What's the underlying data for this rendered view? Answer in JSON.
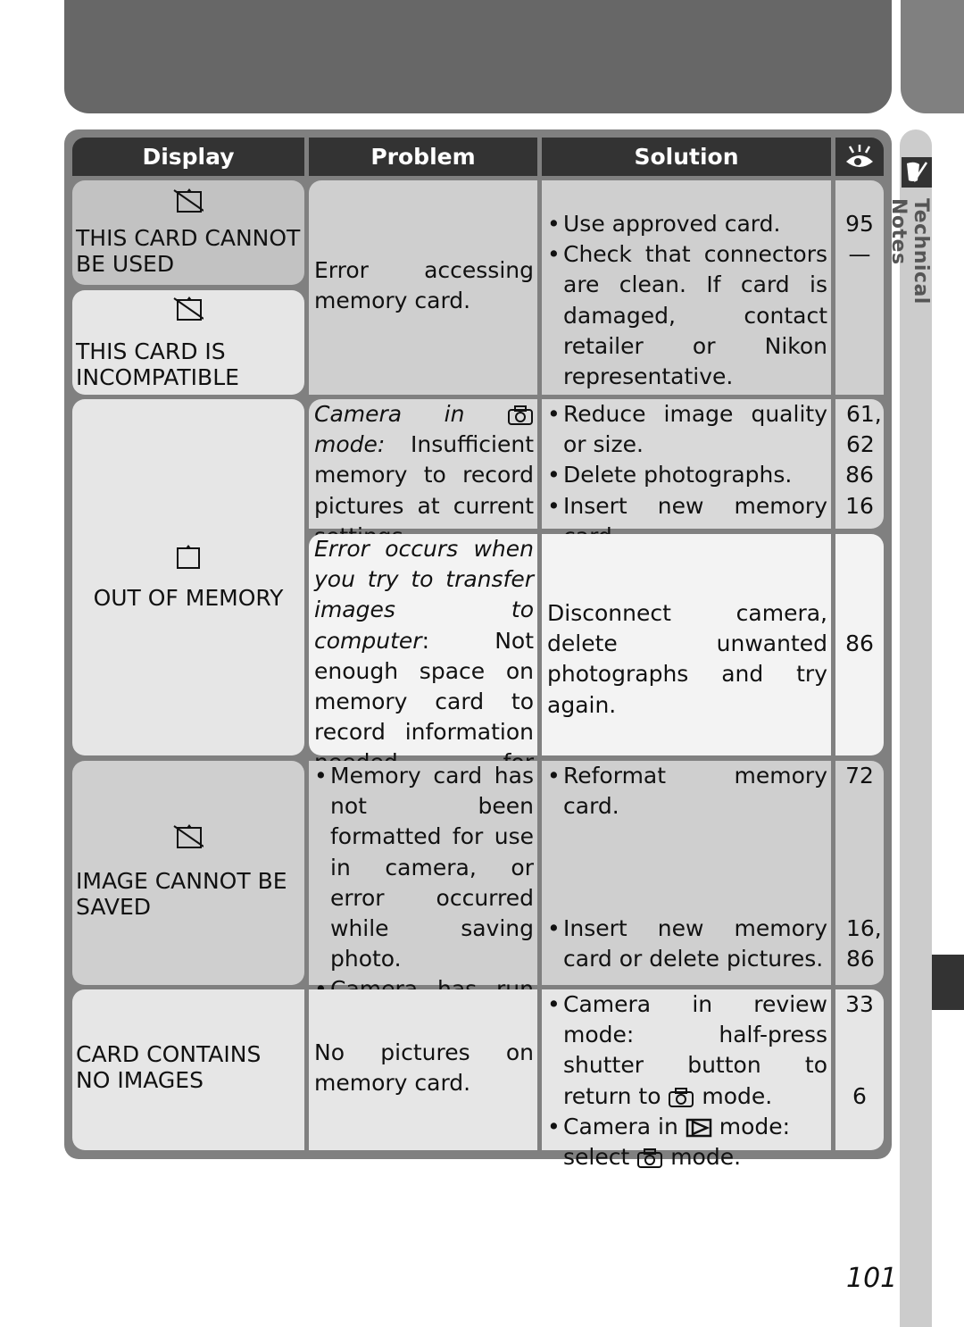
{
  "side_tab": {
    "label": "Technical Notes",
    "icon": "pencil-note-icon"
  },
  "header": {
    "display": "Display",
    "problem": "Problem",
    "solution": "Solution",
    "page_icon": "eye-icon"
  },
  "rows": [
    {
      "displays": [
        {
          "icon": "card-crossed-icon",
          "text": "THIS CARD CANNOT BE USED"
        },
        {
          "icon": "card-crossed-icon",
          "text": "THIS CARD IS INCOMPATIBLE"
        }
      ],
      "problem": "Error accessing memory card.",
      "solutions": [
        {
          "text": "Use approved card.",
          "page": "95"
        },
        {
          "text": "Check that connectors are clean.  If card is damaged, contact retailer or Nikon representative.",
          "page": "—"
        }
      ]
    },
    {
      "display": {
        "icon": "card-icon",
        "text": "OUT OF MEMORY"
      },
      "subrows": [
        {
          "problem_italic": "Camera in [camera] mode:",
          "problem_italic_pre": "Camera in",
          "problem_italic_post": "mode:",
          "problem": "Insufficient memory to record pictures at current settings.",
          "solutions": [
            {
              "text": "Reduce image quality or size.",
              "page": "61, 62"
            },
            {
              "text": "Delete photographs.",
              "page": "86"
            },
            {
              "text": "Insert new memory card.",
              "page": "16"
            }
          ]
        },
        {
          "problem_italic": "Error occurs when you try to transfer images to computer",
          "problem": ": Not enough space on memory card to record information needed for transfer.",
          "solution": "Disconnect camera, delete unwanted photographs and try again.",
          "page": "86"
        }
      ]
    },
    {
      "display": {
        "icon": "card-crossed-icon",
        "text": "IMAGE CANNOT BE SAVED"
      },
      "problems": [
        "Memory card has not been formatted for use in camera, or error occurred while saving photo.",
        "Camera has run out of file numbers."
      ],
      "solutions": [
        {
          "text": "Reformat memory card.",
          "page": "72"
        },
        {
          "text": "Insert new memory card or delete pictures.",
          "page": "16, 86"
        }
      ]
    },
    {
      "display": {
        "text": "CARD CONTAINS NO IMAGES"
      },
      "problem": "No pictures on memory card.",
      "solutions": [
        {
          "pre": "Camera in review mode: half-press shutter button to return to",
          "post": "mode.",
          "page": "33"
        },
        {
          "pre": "Camera in",
          "mid": "mode: select",
          "post": "mode.",
          "page": "6"
        }
      ]
    }
  ],
  "page_number": "101"
}
